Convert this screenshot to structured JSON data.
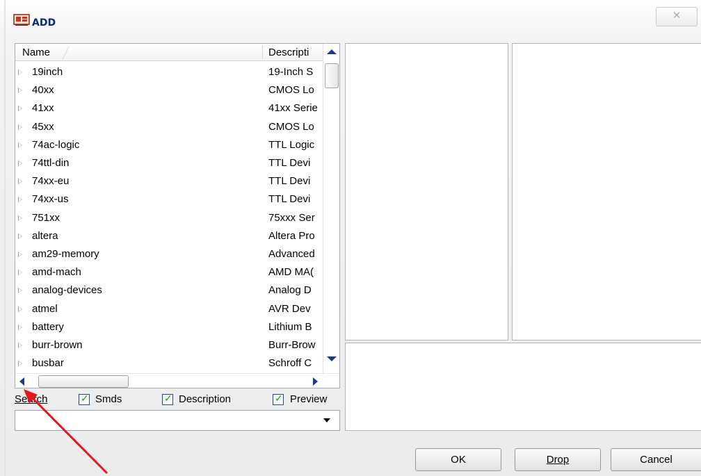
{
  "window": {
    "title": "ADD",
    "close_label": "✕"
  },
  "list": {
    "columns": {
      "name": "Name",
      "description": "Descripti"
    },
    "rows": [
      {
        "name": "19inch",
        "description": "19-Inch S"
      },
      {
        "name": "40xx",
        "description": "CMOS Lo"
      },
      {
        "name": "41xx",
        "description": "41xx Serie"
      },
      {
        "name": "45xx",
        "description": "CMOS Lo"
      },
      {
        "name": "74ac-logic",
        "description": "TTL Logic"
      },
      {
        "name": "74ttl-din",
        "description": "TTL Devi"
      },
      {
        "name": "74xx-eu",
        "description": "TTL Devi"
      },
      {
        "name": "74xx-us",
        "description": "TTL Devi"
      },
      {
        "name": "751xx",
        "description": "75xxx Ser"
      },
      {
        "name": "altera",
        "description": "Altera Pro"
      },
      {
        "name": "am29-memory",
        "description": "Advanced"
      },
      {
        "name": "amd-mach",
        "description": "AMD MA("
      },
      {
        "name": "analog-devices",
        "description": "Analog D"
      },
      {
        "name": "atmel",
        "description": "AVR Dev"
      },
      {
        "name": "battery",
        "description": "Lithium B"
      },
      {
        "name": "burr-brown",
        "description": "Burr-Brow"
      },
      {
        "name": "busbar",
        "description": "Schroff C"
      }
    ]
  },
  "search": {
    "label": "Search",
    "value": "",
    "placeholder": ""
  },
  "options": {
    "smds": {
      "label": "Smds",
      "checked": true
    },
    "description": {
      "label": "Description",
      "checked": true
    },
    "preview": {
      "label": "Preview",
      "checked": true
    }
  },
  "buttons": {
    "ok": "OK",
    "drop": "Drop",
    "cancel": "Cancel"
  },
  "colors": {
    "title": "#0d2a7a",
    "scroll_arrows": "#1a3a8c",
    "check": "#21a121",
    "annotation_arrow": "#e8141b"
  },
  "icons": {
    "app": "add-part-icon",
    "close": "close-icon",
    "expand": "expand-triangle-icon",
    "annotation": "red-arrow-annotation"
  }
}
